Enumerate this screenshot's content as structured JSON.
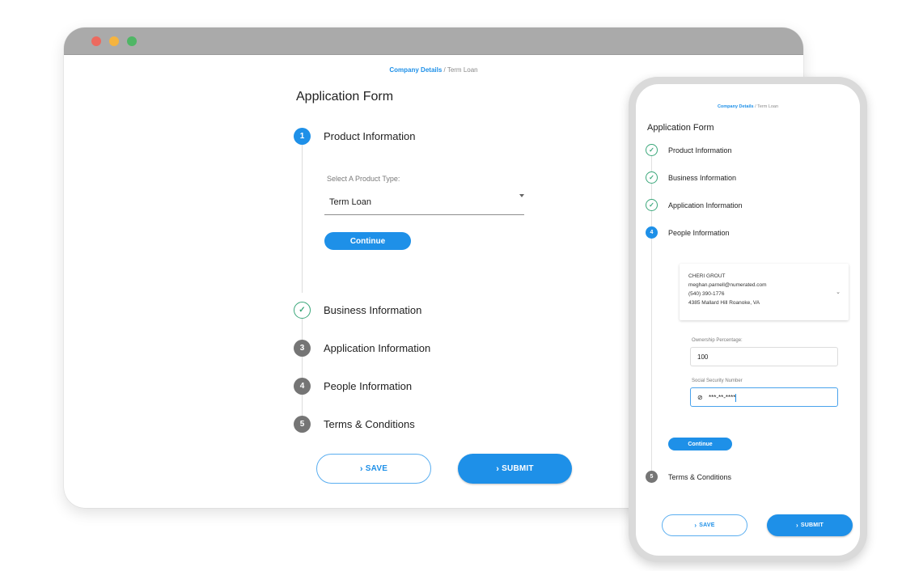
{
  "window_controls": {
    "close_color": "#ec6a5f",
    "minimize_color": "#f5b43f",
    "maximize_color": "#4fb665"
  },
  "colors": {
    "accent": "#1e90e8",
    "step_done": "#3aa77a",
    "step_pending": "#757575"
  },
  "desktop": {
    "breadcrumb": {
      "link": "Company Details",
      "separator": " / ",
      "current": "Term Loan"
    },
    "title": "Application Form",
    "steps": [
      {
        "number": "1",
        "label": "Product Information",
        "state": "active"
      },
      {
        "number": "✓",
        "label": "Business Information",
        "state": "done"
      },
      {
        "number": "3",
        "label": "Application Information",
        "state": "pending"
      },
      {
        "number": "4",
        "label": "People Information",
        "state": "pending"
      },
      {
        "number": "5",
        "label": "Terms & Conditions",
        "state": "pending"
      }
    ],
    "product_type": {
      "label": "Select A Product Type:",
      "value": "Term Loan"
    },
    "continue_label": "Continue",
    "save_label": "SAVE",
    "submit_label": "SUBMIT",
    "chevron_icon": "›"
  },
  "mobile": {
    "breadcrumb": {
      "link": "Company Details",
      "separator": " / ",
      "current": "Term Loan"
    },
    "title": "Application Form",
    "steps": [
      {
        "number": "✓",
        "label": "Product Information",
        "state": "done"
      },
      {
        "number": "✓",
        "label": "Business Information",
        "state": "done"
      },
      {
        "number": "✓",
        "label": "Application Information",
        "state": "done"
      },
      {
        "number": "4",
        "label": "People Information",
        "state": "active"
      },
      {
        "number": "5",
        "label": "Terms & Conditions",
        "state": "pending"
      }
    ],
    "person": {
      "name": "CHERI GROUT",
      "email": "meghan.parnell@numerated.com",
      "phone": "(540) 390-1776",
      "address": "4385 Mallard Hill Roanoke, VA",
      "expand_icon": "⌄"
    },
    "ownership": {
      "label": "Ownership Percentage:",
      "value": "100"
    },
    "ssn": {
      "label": "Social Security Number",
      "value": "***-**-****",
      "visibility_icon": "⊘"
    },
    "continue_label": "Continue",
    "save_label": "SAVE",
    "submit_label": "SUBMIT",
    "chevron_icon": "›"
  }
}
